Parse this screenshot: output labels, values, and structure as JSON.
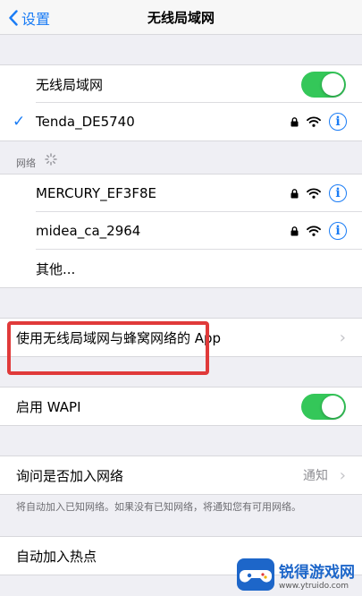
{
  "nav": {
    "back_label": "设置",
    "title": "无线局域网"
  },
  "wlan_toggle": {
    "label": "无线局域网",
    "on": true
  },
  "connected": {
    "name": "Tenda_DE5740"
  },
  "networks_header": "网络",
  "networks": [
    {
      "name": "MERCURY_EF3F8E"
    },
    {
      "name": "midea_ca_2964"
    }
  ],
  "other_label": "其他...",
  "apps_row": {
    "label": "使用无线局域网与蜂窝网络的 App"
  },
  "wapi": {
    "label": "启用 WAPI",
    "on": true
  },
  "ask_join": {
    "label": "询问是否加入网络",
    "value": "通知"
  },
  "ask_join_footer": "将自动加入已知网络。如果没有已知网络，将通知您有可用网络。",
  "auto_hotspot": {
    "label": "自动加入热点"
  },
  "watermark": {
    "name": "锐得游戏网",
    "url": "www.ytruido.com"
  },
  "colors": {
    "accent": "#1a7cf5",
    "toggle_on": "#34c759",
    "highlight": "#e03a3a"
  }
}
